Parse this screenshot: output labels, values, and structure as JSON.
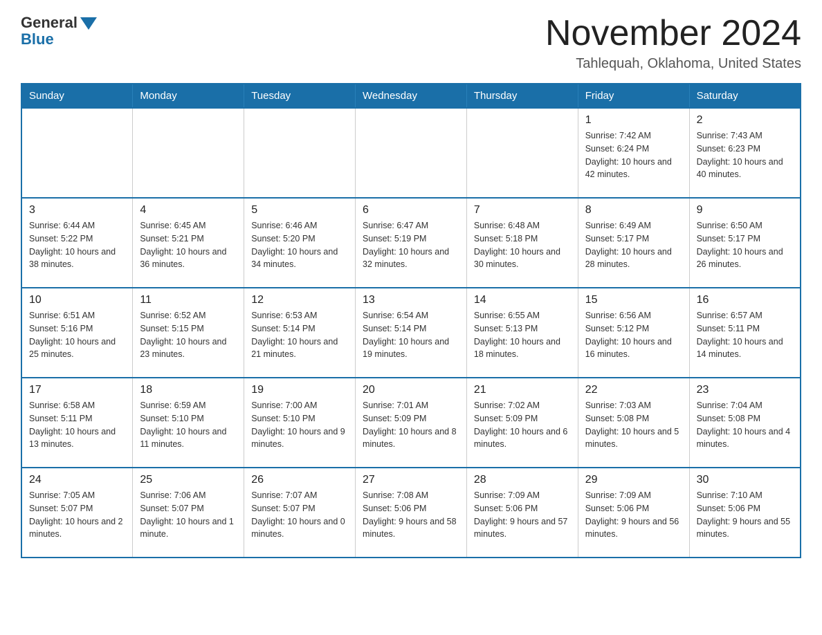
{
  "logo": {
    "text_general": "General",
    "text_blue": "Blue"
  },
  "title": "November 2024",
  "location": "Tahlequah, Oklahoma, United States",
  "days_of_week": [
    "Sunday",
    "Monday",
    "Tuesday",
    "Wednesday",
    "Thursday",
    "Friday",
    "Saturday"
  ],
  "weeks": [
    [
      {
        "day": "",
        "sunrise": "",
        "sunset": "",
        "daylight": ""
      },
      {
        "day": "",
        "sunrise": "",
        "sunset": "",
        "daylight": ""
      },
      {
        "day": "",
        "sunrise": "",
        "sunset": "",
        "daylight": ""
      },
      {
        "day": "",
        "sunrise": "",
        "sunset": "",
        "daylight": ""
      },
      {
        "day": "",
        "sunrise": "",
        "sunset": "",
        "daylight": ""
      },
      {
        "day": "1",
        "sunrise": "Sunrise: 7:42 AM",
        "sunset": "Sunset: 6:24 PM",
        "daylight": "Daylight: 10 hours and 42 minutes."
      },
      {
        "day": "2",
        "sunrise": "Sunrise: 7:43 AM",
        "sunset": "Sunset: 6:23 PM",
        "daylight": "Daylight: 10 hours and 40 minutes."
      }
    ],
    [
      {
        "day": "3",
        "sunrise": "Sunrise: 6:44 AM",
        "sunset": "Sunset: 5:22 PM",
        "daylight": "Daylight: 10 hours and 38 minutes."
      },
      {
        "day": "4",
        "sunrise": "Sunrise: 6:45 AM",
        "sunset": "Sunset: 5:21 PM",
        "daylight": "Daylight: 10 hours and 36 minutes."
      },
      {
        "day": "5",
        "sunrise": "Sunrise: 6:46 AM",
        "sunset": "Sunset: 5:20 PM",
        "daylight": "Daylight: 10 hours and 34 minutes."
      },
      {
        "day": "6",
        "sunrise": "Sunrise: 6:47 AM",
        "sunset": "Sunset: 5:19 PM",
        "daylight": "Daylight: 10 hours and 32 minutes."
      },
      {
        "day": "7",
        "sunrise": "Sunrise: 6:48 AM",
        "sunset": "Sunset: 5:18 PM",
        "daylight": "Daylight: 10 hours and 30 minutes."
      },
      {
        "day": "8",
        "sunrise": "Sunrise: 6:49 AM",
        "sunset": "Sunset: 5:17 PM",
        "daylight": "Daylight: 10 hours and 28 minutes."
      },
      {
        "day": "9",
        "sunrise": "Sunrise: 6:50 AM",
        "sunset": "Sunset: 5:17 PM",
        "daylight": "Daylight: 10 hours and 26 minutes."
      }
    ],
    [
      {
        "day": "10",
        "sunrise": "Sunrise: 6:51 AM",
        "sunset": "Sunset: 5:16 PM",
        "daylight": "Daylight: 10 hours and 25 minutes."
      },
      {
        "day": "11",
        "sunrise": "Sunrise: 6:52 AM",
        "sunset": "Sunset: 5:15 PM",
        "daylight": "Daylight: 10 hours and 23 minutes."
      },
      {
        "day": "12",
        "sunrise": "Sunrise: 6:53 AM",
        "sunset": "Sunset: 5:14 PM",
        "daylight": "Daylight: 10 hours and 21 minutes."
      },
      {
        "day": "13",
        "sunrise": "Sunrise: 6:54 AM",
        "sunset": "Sunset: 5:14 PM",
        "daylight": "Daylight: 10 hours and 19 minutes."
      },
      {
        "day": "14",
        "sunrise": "Sunrise: 6:55 AM",
        "sunset": "Sunset: 5:13 PM",
        "daylight": "Daylight: 10 hours and 18 minutes."
      },
      {
        "day": "15",
        "sunrise": "Sunrise: 6:56 AM",
        "sunset": "Sunset: 5:12 PM",
        "daylight": "Daylight: 10 hours and 16 minutes."
      },
      {
        "day": "16",
        "sunrise": "Sunrise: 6:57 AM",
        "sunset": "Sunset: 5:11 PM",
        "daylight": "Daylight: 10 hours and 14 minutes."
      }
    ],
    [
      {
        "day": "17",
        "sunrise": "Sunrise: 6:58 AM",
        "sunset": "Sunset: 5:11 PM",
        "daylight": "Daylight: 10 hours and 13 minutes."
      },
      {
        "day": "18",
        "sunrise": "Sunrise: 6:59 AM",
        "sunset": "Sunset: 5:10 PM",
        "daylight": "Daylight: 10 hours and 11 minutes."
      },
      {
        "day": "19",
        "sunrise": "Sunrise: 7:00 AM",
        "sunset": "Sunset: 5:10 PM",
        "daylight": "Daylight: 10 hours and 9 minutes."
      },
      {
        "day": "20",
        "sunrise": "Sunrise: 7:01 AM",
        "sunset": "Sunset: 5:09 PM",
        "daylight": "Daylight: 10 hours and 8 minutes."
      },
      {
        "day": "21",
        "sunrise": "Sunrise: 7:02 AM",
        "sunset": "Sunset: 5:09 PM",
        "daylight": "Daylight: 10 hours and 6 minutes."
      },
      {
        "day": "22",
        "sunrise": "Sunrise: 7:03 AM",
        "sunset": "Sunset: 5:08 PM",
        "daylight": "Daylight: 10 hours and 5 minutes."
      },
      {
        "day": "23",
        "sunrise": "Sunrise: 7:04 AM",
        "sunset": "Sunset: 5:08 PM",
        "daylight": "Daylight: 10 hours and 4 minutes."
      }
    ],
    [
      {
        "day": "24",
        "sunrise": "Sunrise: 7:05 AM",
        "sunset": "Sunset: 5:07 PM",
        "daylight": "Daylight: 10 hours and 2 minutes."
      },
      {
        "day": "25",
        "sunrise": "Sunrise: 7:06 AM",
        "sunset": "Sunset: 5:07 PM",
        "daylight": "Daylight: 10 hours and 1 minute."
      },
      {
        "day": "26",
        "sunrise": "Sunrise: 7:07 AM",
        "sunset": "Sunset: 5:07 PM",
        "daylight": "Daylight: 10 hours and 0 minutes."
      },
      {
        "day": "27",
        "sunrise": "Sunrise: 7:08 AM",
        "sunset": "Sunset: 5:06 PM",
        "daylight": "Daylight: 9 hours and 58 minutes."
      },
      {
        "day": "28",
        "sunrise": "Sunrise: 7:09 AM",
        "sunset": "Sunset: 5:06 PM",
        "daylight": "Daylight: 9 hours and 57 minutes."
      },
      {
        "day": "29",
        "sunrise": "Sunrise: 7:09 AM",
        "sunset": "Sunset: 5:06 PM",
        "daylight": "Daylight: 9 hours and 56 minutes."
      },
      {
        "day": "30",
        "sunrise": "Sunrise: 7:10 AM",
        "sunset": "Sunset: 5:06 PM",
        "daylight": "Daylight: 9 hours and 55 minutes."
      }
    ]
  ]
}
